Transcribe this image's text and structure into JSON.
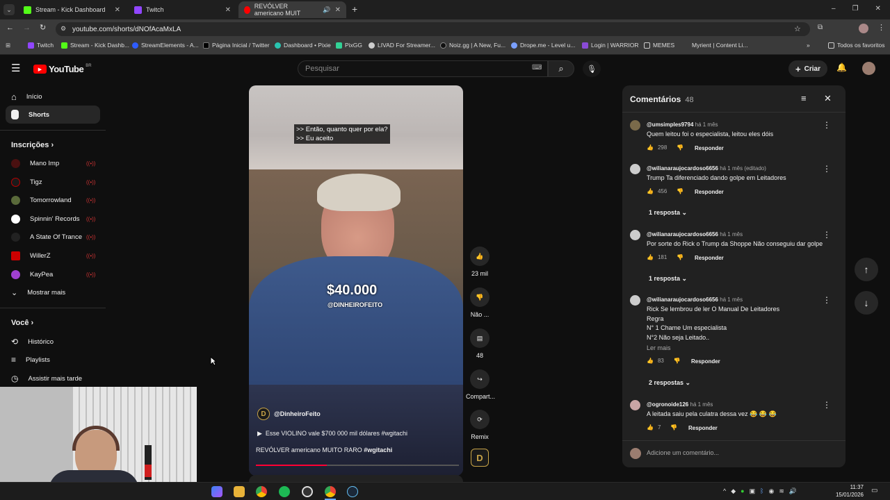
{
  "browser": {
    "tabs": [
      {
        "title": "Stream - Kick Dashboard",
        "color": "#53fc18"
      },
      {
        "title": "Twitch",
        "color": "#9146ff"
      },
      {
        "title": "REVÓLVER americano MUIT",
        "color": "#ff0000"
      }
    ],
    "new_tab": "+",
    "url": "youtube.com/shorts/dNOfAcaMxLA",
    "bookmarks": [
      "Twitch",
      "Stream - Kick Dashb...",
      "StreamElements - A...",
      "Página Inicial / Twitter",
      "Dashboard • Pixie",
      "PixGG",
      "LIVAD For Streamer...",
      "Noiz.gg | A New, Fu...",
      "Drope.me - Level u...",
      "Login | WARRIOR",
      "MEMES",
      "Myrient | Content Li..."
    ],
    "all_bookmarks": "Todos os favoritos"
  },
  "yt": {
    "logo": "YouTube",
    "region": "BR",
    "search_placeholder": "Pesquisar",
    "create_label": "Criar"
  },
  "sidebar": {
    "main": [
      {
        "label": "Início",
        "icon": "home-icon"
      },
      {
        "label": "Shorts",
        "icon": "shorts-icon"
      }
    ],
    "subs_title": "Inscrições",
    "subs": [
      {
        "label": "Mano Imp",
        "color": "#222"
      },
      {
        "label": "Tigz",
        "color": "#b00"
      },
      {
        "label": "Tomorrowland",
        "color": "#5a6a3a"
      },
      {
        "label": "Spinnin' Records",
        "color": "#111"
      },
      {
        "label": "A State Of Trance",
        "color": "#222"
      },
      {
        "label": "WillerZ",
        "color": "#c00"
      },
      {
        "label": "KayPea",
        "color": "#a040d0"
      }
    ],
    "more": "Mostrar mais",
    "you_title": "Você",
    "you": [
      {
        "label": "Histórico",
        "icon": "history-icon"
      },
      {
        "label": "Playlists",
        "icon": "playlists-icon"
      },
      {
        "label": "Assistir mais tarde",
        "icon": "watch-later-icon"
      }
    ]
  },
  "video": {
    "caption1": ">> Então, quanto quer por ela?",
    "caption2": ">> Eu aceito",
    "overlay_price": "$40.000",
    "overlay_handle": "@DINHEIROFEITO",
    "channel": "@DinheiroFeito",
    "channel_initial": "D",
    "song": "Esse VIOLINO vale $700 000 mil dólares #wgitachi",
    "title": "REVÓLVER americano MUITO RARO",
    "hashtag": "#wgitachi",
    "progress": 0.35
  },
  "actions": {
    "likes": "23 mil",
    "dislike": "Não ...",
    "comments": "48",
    "share": "Compart...",
    "remix": "Remix"
  },
  "comments_panel": {
    "title": "Comentários",
    "count": "48",
    "reply_label": "Responder",
    "items": [
      {
        "user": "@umsimples9794",
        "time": "há 1 mês",
        "text": "Quem leitou foi o especialista, leitou eles dóis",
        "likes": "298"
      },
      {
        "user": "@wilianaraujocardoso6656",
        "time": "há 1 mês (editado)",
        "text": "Trump Ta diferenciado dando golpe em Leitadores",
        "likes": "456",
        "replies": "1 resposta"
      },
      {
        "user": "@wilianaraujocardoso6656",
        "time": "há 1 mês",
        "text": "Por sorte do Rick o Trump da Shoppe Não conseguiu dar golpe",
        "likes": "181",
        "replies": "1 resposta"
      },
      {
        "user": "@wilianaraujocardoso6656",
        "time": "há 1 mês",
        "lines": [
          "Rick Se lembrou  de ler O Manual De Leitadores",
          "Regra",
          "N° 1 Chame Um especialista",
          "N°2 Não seja Leitado.."
        ],
        "more": "Ler mais",
        "likes": "83",
        "replies": "2 respostas"
      },
      {
        "user": "@ogronoide126",
        "time": "há 1 mês",
        "text": "A leitada saiu pela culatra dessa vez 😂 😂 😂",
        "likes": "7"
      }
    ],
    "add_placeholder": "Adicione um comentário..."
  },
  "taskbar": {
    "time": "11:37",
    "date": "15/01/2026"
  }
}
